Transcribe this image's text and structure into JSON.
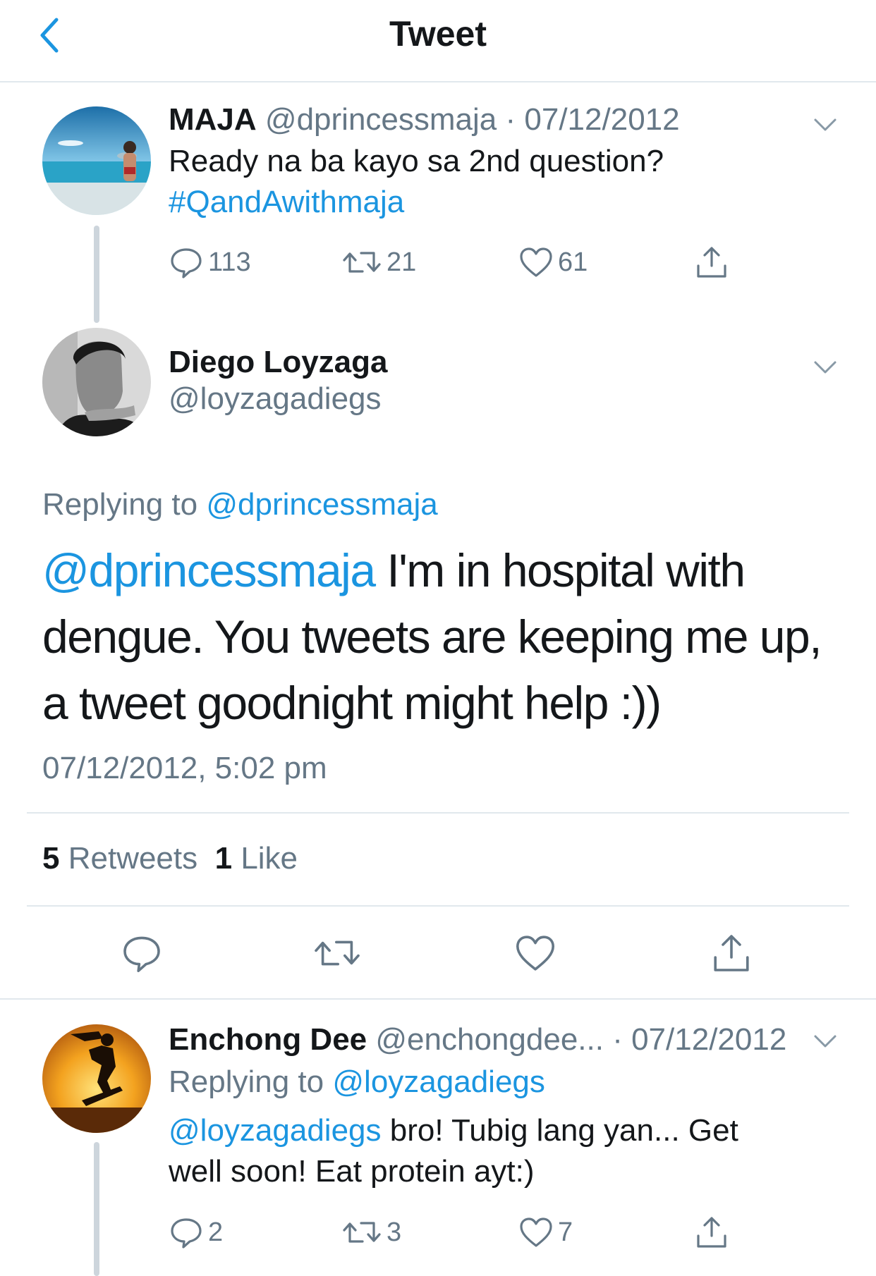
{
  "header": {
    "title": "Tweet"
  },
  "parent_tweet": {
    "name": "MAJA",
    "handle": "@dprincessmaja",
    "date": "· 07/12/2012",
    "text": "Ready na ba kayo sa 2nd question?",
    "hashtag": "#QandAwithmaja",
    "replies": "113",
    "retweets": "21",
    "likes": "61"
  },
  "main_tweet": {
    "name": "Diego Loyzaga",
    "handle": "@loyzagadiegs",
    "replying_label": "Replying to",
    "replying_handle": "@dprincessmaja",
    "mention": "@dprincessmaja",
    "text": " I'm in hospital with dengue. You tweets are keeping me up, a tweet goodnight might help :))",
    "timestamp": "07/12/2012, 5:02 pm",
    "retweet_count": "5",
    "retweet_label": "Retweets",
    "like_count": "1",
    "like_label": "Like"
  },
  "reply_tweet": {
    "name": "Enchong Dee",
    "handle": "@enchongdee...",
    "date": "· 07/12/2012",
    "replying_label": "Replying to",
    "replying_handle": "@loyzagadiegs",
    "mention": "@loyzagadiegs",
    "text_line1": " bro! Tubig lang yan... Get",
    "text_line2": "well soon! Eat protein ayt:)",
    "replies": "2",
    "retweets": "3",
    "likes": "7"
  },
  "colors": {
    "link_blue": "#1b95e0",
    "muted_gray": "#657786",
    "divider": "#e1e8ed",
    "thread_line": "#cdd5dc"
  },
  "icons": [
    "back-arrow-icon",
    "chevron-down-icon",
    "reply-icon",
    "retweet-icon",
    "like-icon",
    "share-icon"
  ]
}
